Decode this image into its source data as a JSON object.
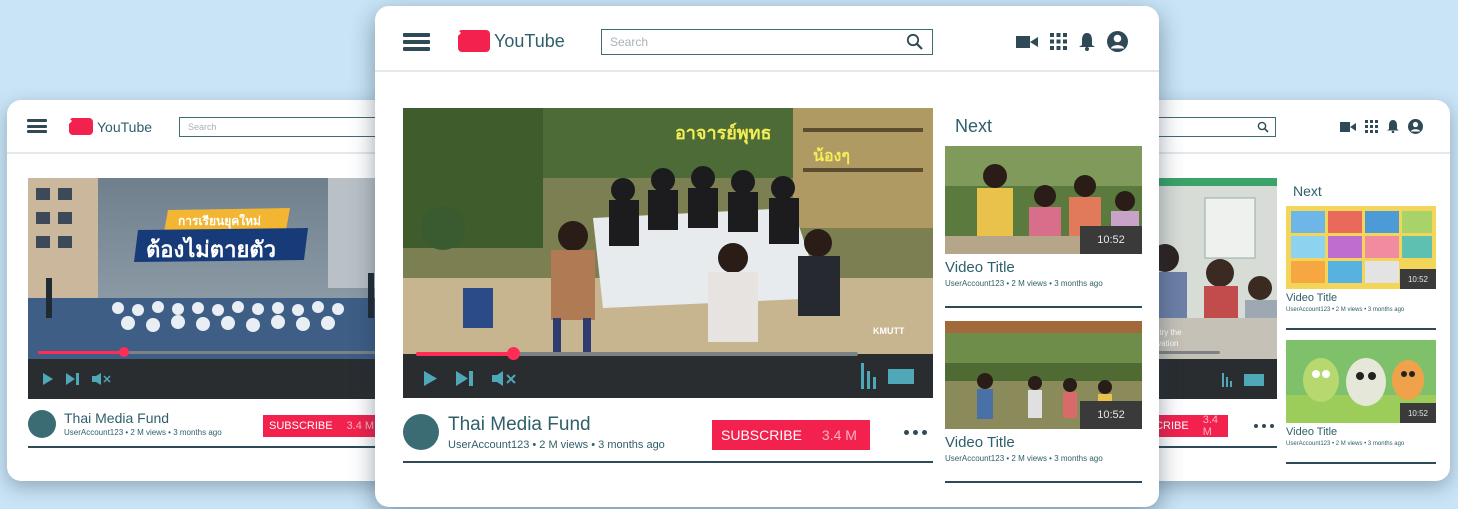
{
  "colors": {
    "accent": "#f2214e",
    "teal": "#2f5f6a",
    "dark": "#2f4a56",
    "progress": "#ff2d55"
  },
  "brand": {
    "name": "YouTube",
    "logo_icon": "play-logo-icon"
  },
  "search": {
    "placeholder": "Search",
    "icon": "search-icon"
  },
  "header_icons": [
    "video-camera-icon",
    "apps-grid-icon",
    "bell-icon",
    "account-icon"
  ],
  "left": {
    "video_overlay": {
      "line1": "การเรียนยุคใหม่",
      "line2": "ต้องไม่ตายตัว"
    },
    "progress": 0.24,
    "channel": {
      "name": "Thai Media Fund",
      "meta": "UserAccount123 • 2 M views • 3 months ago"
    },
    "subscribe": {
      "label": "SUBSCRIBE",
      "count": "3.4 M"
    }
  },
  "center": {
    "video_overlay": {
      "line1": "อาจารย์พุทธ",
      "line2": "น้องๆ",
      "logo": "KMUTT"
    },
    "progress": 0.22,
    "channel": {
      "name": "Thai Media Fund",
      "meta": "UserAccount123 • 2 M views • 3 months ago"
    },
    "subscribe": {
      "label": "SUBSCRIBE",
      "count": "3.4 M"
    },
    "next_label": "Next",
    "next_videos": [
      {
        "title": "Video Title",
        "meta": "UserAccount123 • 2 M views • 3 months ago",
        "duration": "10:52"
      },
      {
        "title": "Video Title",
        "meta": "UserAccount123 • 2 M views • 3 months ago",
        "duration": "10:52"
      }
    ]
  },
  "right": {
    "video_overlay": {
      "caption_line1": "country the",
      "caption_line2": "innovation"
    },
    "subscribe": {
      "label": "SUBSCRIBE",
      "count": "3.4 M"
    },
    "next_label": "Next",
    "next_videos": [
      {
        "title": "Video Title",
        "meta": "UserAccount123 • 2 M views • 3 months ago",
        "duration": "10:52"
      },
      {
        "title": "Video Title",
        "meta": "UserAccount123 • 2 M views • 3 months ago",
        "duration": "10:52"
      }
    ]
  }
}
